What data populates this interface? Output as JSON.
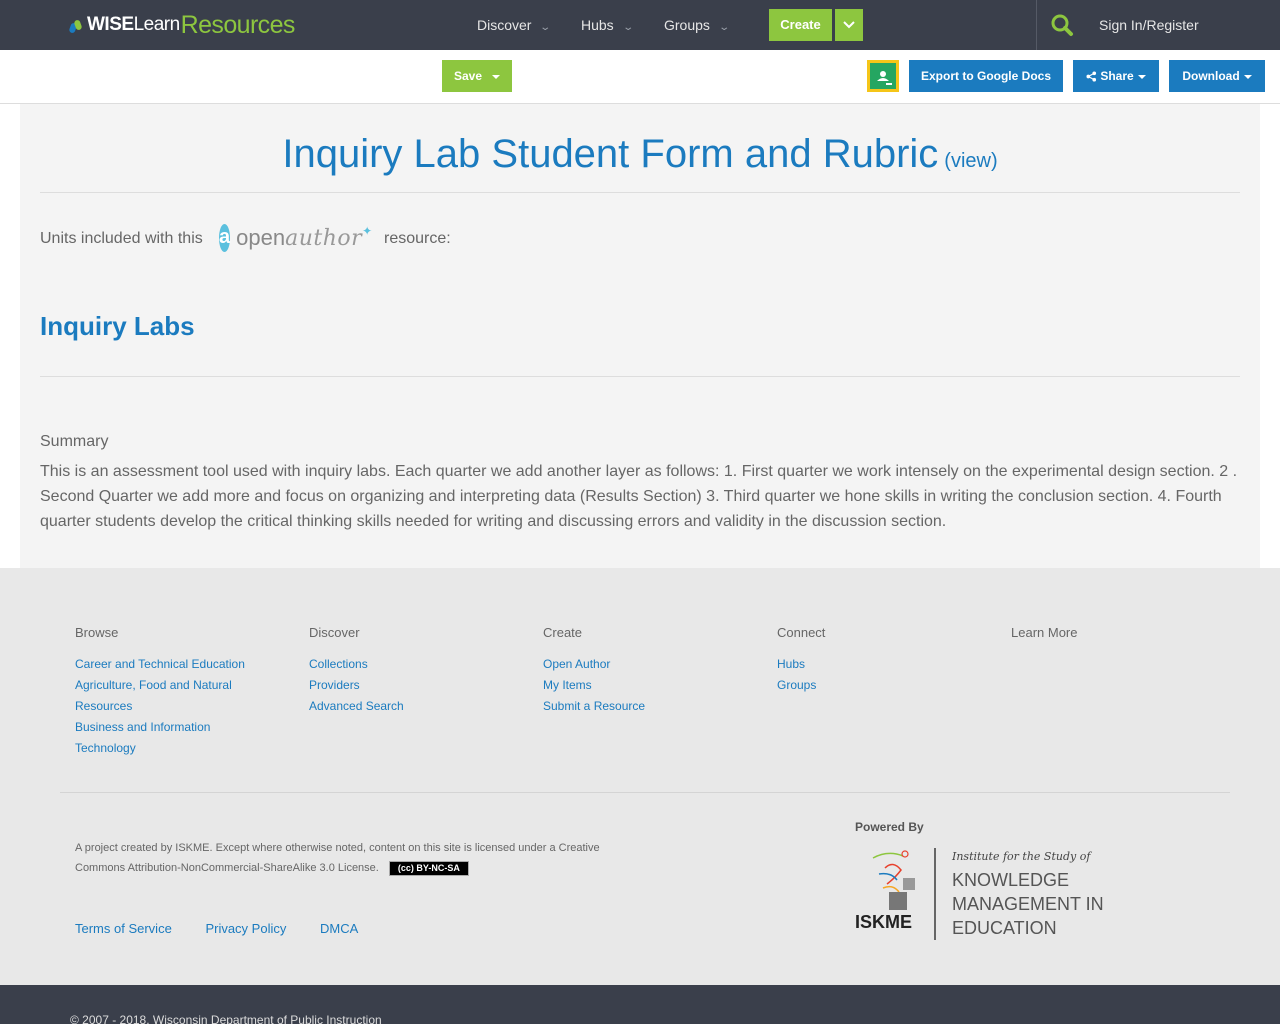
{
  "nav": {
    "logo": {
      "part1": "WISE",
      "part2": "Learn",
      "part3": "Resources"
    },
    "items": [
      {
        "label": "Discover"
      },
      {
        "label": "Hubs"
      },
      {
        "label": "Groups"
      }
    ],
    "create_label": "Create",
    "signin_label": "Sign In/Register"
  },
  "toolbar": {
    "save_label": "Save",
    "export_label": "Export to Google Docs",
    "share_label": "Share",
    "download_label": "Download"
  },
  "resource": {
    "title": "Inquiry Lab Student Form and Rubric",
    "view_label": "(view)",
    "units_prefix": "Units included with this",
    "openauthor_part1": "open",
    "openauthor_part2": "author",
    "units_suffix": "resource:",
    "unit_title": "Inquiry Labs",
    "summary_label": "Summary",
    "summary_text": "This is an assessment tool used with inquiry labs. Each quarter we add another layer as follows: 1. First quarter we work intensely on the experimental design section. 2 . Second Quarter we add more and focus on organizing and interpreting data (Results Section) 3. Third quarter we hone skills in writing the conclusion section. 4. Fourth quarter students develop the critical thinking skills needed for writing and discussing errors and validity in the discussion section."
  },
  "footer": {
    "columns": [
      {
        "heading": "Browse",
        "links": [
          "Career and Technical Education",
          "Agriculture, Food and Natural Resources",
          "Business and Information Technology"
        ]
      },
      {
        "heading": "Discover",
        "links": [
          "Collections",
          "Providers",
          "Advanced Search"
        ]
      },
      {
        "heading": "Create",
        "links": [
          "Open Author",
          "My Items",
          "Submit a Resource"
        ]
      },
      {
        "heading": "Connect",
        "links": [
          "Hubs",
          "Groups"
        ]
      },
      {
        "heading": "Learn More",
        "links": []
      }
    ],
    "license_text": "A project created by ISKME. Except where otherwise noted, content on this site is licensed under a Creative Commons Attribution-NonCommercial-ShareAlike 3.0 License.",
    "cc_badge": "(cc) BY-NC-SA",
    "links": [
      "Terms of Service",
      "Privacy Policy",
      "DMCA"
    ],
    "powered_by": "Powered By",
    "iskme_institute": "Institute for the Study of",
    "iskme_line1": "KNOWLEDGE",
    "iskme_line2": "MANAGEMENT IN",
    "iskme_line3": "EDUCATION",
    "iskme_short": "ISKME",
    "copyright": "© 2007 - 2018, Wisconsin Department of Public Instruction"
  },
  "colors": {
    "nav_bg": "#3a3f4b",
    "accent_green": "#8dc63f",
    "accent_blue": "#1b7bbf"
  }
}
